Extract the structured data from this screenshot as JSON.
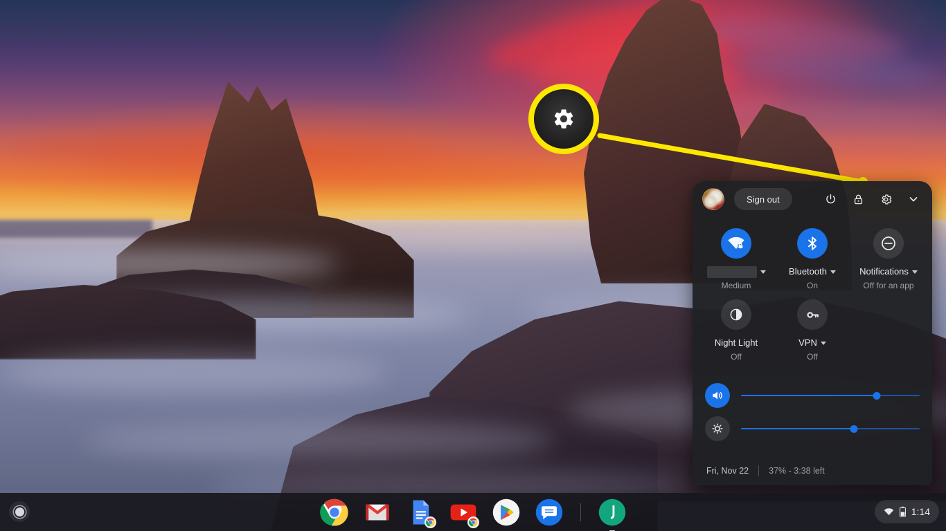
{
  "wallpaper": {
    "name": "sunset-coastal-rocks-wallpaper"
  },
  "callout": {
    "icon": "gear-icon",
    "ring_color": "#ffe800",
    "line_color": "#ffe800"
  },
  "tray": {
    "header": {
      "avatar_label": "user-avatar",
      "sign_out_label": "Sign out",
      "power_label": "power-icon",
      "lock_label": "lock-icon",
      "settings_label": "settings-gear-icon",
      "collapse_label": "chevron-down-icon"
    },
    "tiles": [
      {
        "id": "network",
        "icon": "wifi-locked-icon",
        "label": "",
        "label_redacted": true,
        "has_caret": true,
        "sub": "Medium",
        "state": "on"
      },
      {
        "id": "bluetooth",
        "icon": "bluetooth-icon",
        "label": "Bluetooth",
        "label_redacted": false,
        "has_caret": true,
        "sub": "On",
        "state": "on"
      },
      {
        "id": "notifications",
        "icon": "do-not-disturb-icon",
        "label": "Notifications",
        "label_redacted": false,
        "has_caret": true,
        "sub": "Off for an app",
        "state": "off"
      },
      {
        "id": "night-light",
        "icon": "moon-icon",
        "label": "Night Light",
        "label_redacted": false,
        "has_caret": false,
        "sub": "Off",
        "state": "off"
      },
      {
        "id": "vpn",
        "icon": "key-icon",
        "label": "VPN",
        "label_redacted": false,
        "has_caret": true,
        "sub": "Off",
        "state": "off"
      }
    ],
    "sliders": [
      {
        "id": "volume",
        "icon": "volume-up-icon",
        "value": 76,
        "state": "on"
      },
      {
        "id": "brightness",
        "icon": "brightness-icon",
        "value": 63,
        "state": "off"
      }
    ],
    "footer": {
      "date": "Fri, Nov 22",
      "battery": "37% - 3:38 left"
    },
    "accent_color": "#1a73e8",
    "background_color": "#202124"
  },
  "shelf": {
    "launcher_label": "launcher-button",
    "apps": [
      {
        "id": "chrome",
        "name": "Google Chrome",
        "badge": false,
        "running": false
      },
      {
        "id": "gmail",
        "name": "Gmail",
        "badge": false,
        "running": false
      },
      {
        "id": "docs",
        "name": "Google Docs",
        "badge": true,
        "running": false
      },
      {
        "id": "youtube",
        "name": "YouTube",
        "badge": true,
        "running": false
      },
      {
        "id": "play-store",
        "name": "Google Play Store",
        "badge": false,
        "running": false
      },
      {
        "id": "messages",
        "name": "Google Messages",
        "badge": false,
        "running": false
      },
      {
        "id": "keep",
        "name": "Google Keep",
        "badge": false,
        "running": true
      }
    ],
    "status": {
      "wifi_icon": "wifi-icon",
      "battery_icon": "battery-icon",
      "time": "1:14"
    }
  }
}
